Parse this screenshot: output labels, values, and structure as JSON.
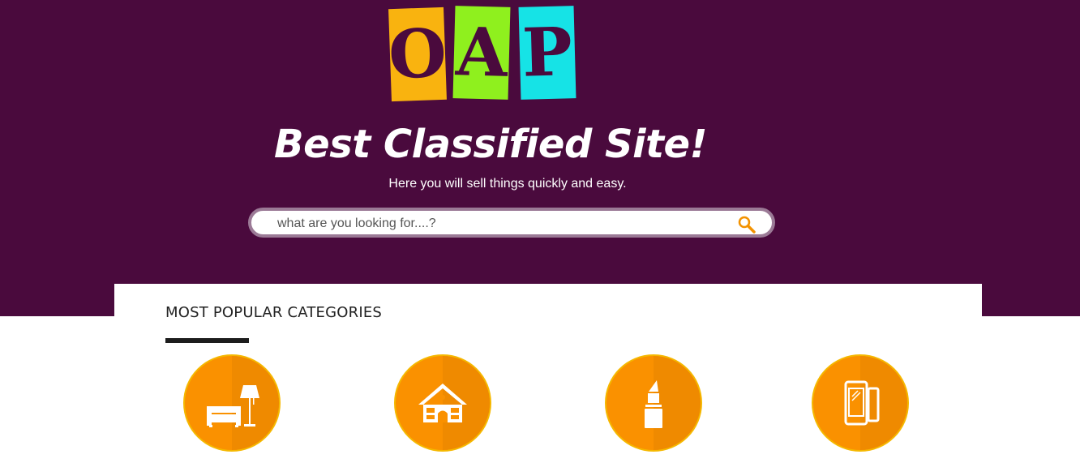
{
  "logo": {
    "letters": [
      "O",
      "A",
      "P"
    ]
  },
  "hero": {
    "headline": "Best Classified Site!",
    "subline": "Here you will sell things quickly and easy."
  },
  "search": {
    "placeholder": "what are you looking for....?",
    "icon": "search-icon"
  },
  "categories": {
    "title": "MOST POPULAR CATEGORIES",
    "items": [
      {
        "icon": "furniture-icon"
      },
      {
        "icon": "house-icon"
      },
      {
        "icon": "lipstick-icon"
      },
      {
        "icon": "phones-icon"
      }
    ]
  },
  "colors": {
    "hero_bg": "#4a0a3d",
    "accent": "#fa9100",
    "tile_1": "#f9b30f",
    "tile_2": "#8ff01e",
    "tile_3": "#16e3e6"
  }
}
